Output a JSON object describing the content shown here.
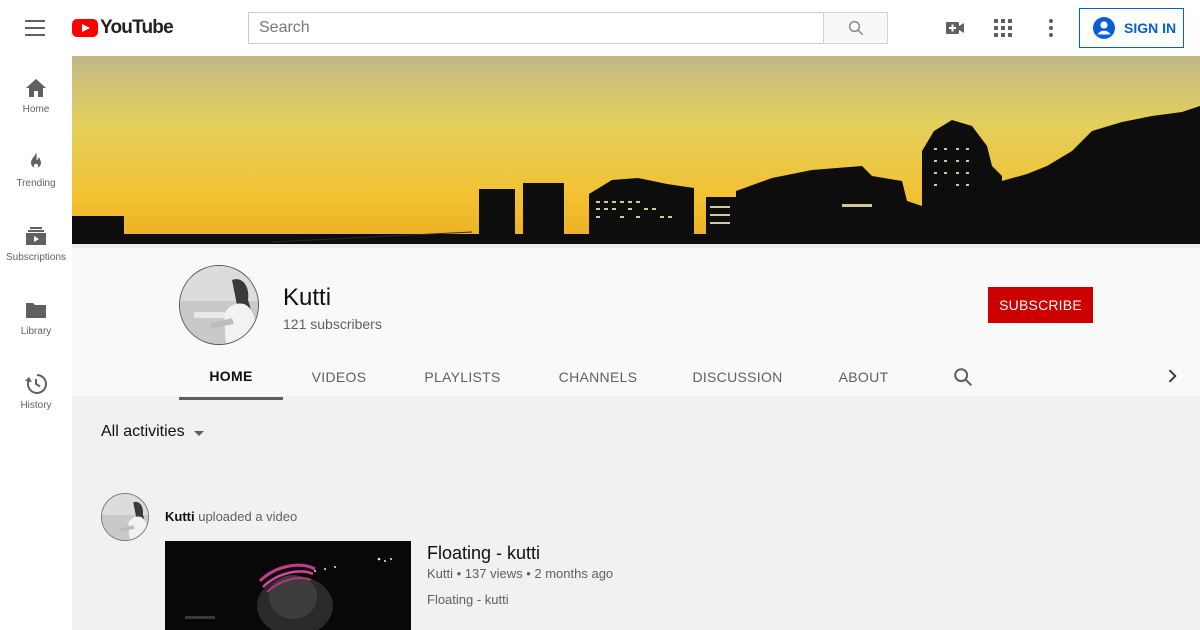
{
  "header": {
    "logo_text": "YouTube",
    "search_placeholder": "Search",
    "signin_label": "SIGN IN"
  },
  "sidebar": {
    "items": [
      {
        "label": "Home",
        "icon": "home-icon"
      },
      {
        "label": "Trending",
        "icon": "fire-icon"
      },
      {
        "label": "Subscriptions",
        "icon": "subscriptions-icon"
      },
      {
        "label": "Library",
        "icon": "folder-icon"
      },
      {
        "label": "History",
        "icon": "history-icon"
      }
    ]
  },
  "channel": {
    "name": "Kutti",
    "subscribers": "121 subscribers",
    "subscribe_label": "SUBSCRIBE",
    "tabs": [
      "HOME",
      "VIDEOS",
      "PLAYLISTS",
      "CHANNELS",
      "DISCUSSION",
      "ABOUT"
    ],
    "active_tab": "HOME"
  },
  "activity": {
    "filter_label": "All activities",
    "author": "Kutti",
    "action": " uploaded a video",
    "video": {
      "title": "Floating - kutti",
      "channel": "Kutti",
      "views": "137 views",
      "age": "2 months ago",
      "description": "Floating - kutti"
    }
  },
  "colors": {
    "brand_red": "#ff0000",
    "subscribe_red": "#cc0000",
    "link_blue": "#065fd4"
  }
}
